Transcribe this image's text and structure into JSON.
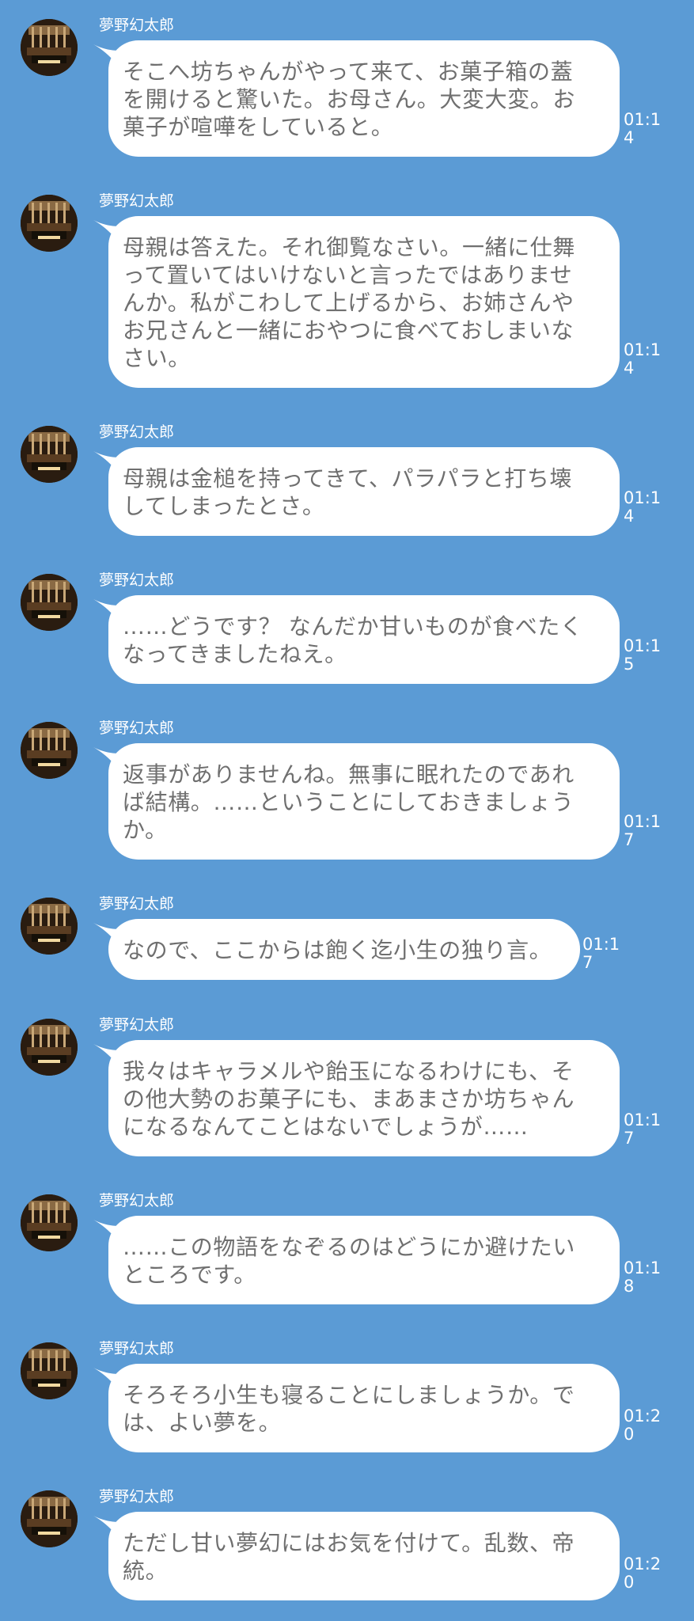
{
  "chat": {
    "messages": [
      {
        "sender": "夢野幻太郎",
        "text": "そこへ坊ちゃんがやって来て、お菓子箱の蓋を開けると驚いた。お母さん。大変大変。お菓子が喧嘩をしていると。",
        "time": "01:14"
      },
      {
        "sender": "夢野幻太郎",
        "text": "母親は答えた。それ御覧なさい。一緒に仕舞って置いてはいけないと言ったではありませんか。私がこわして上げるから、お姉さんやお兄さんと一緒におやつに食べておしまいなさい。",
        "time": "01:14"
      },
      {
        "sender": "夢野幻太郎",
        "text": "母親は金槌を持ってきて、パラパラと打ち壊してしまったとさ。",
        "time": "01:14"
      },
      {
        "sender": "夢野幻太郎",
        "text": "……どうです？ なんだか甘いものが食べたくなってきましたねえ。",
        "time": "01:15"
      },
      {
        "sender": "夢野幻太郎",
        "text": "返事がありませんね。無事に眠れたのであれば結構。……ということにしておきましょうか。",
        "time": "01:17"
      },
      {
        "sender": "夢野幻太郎",
        "text": "なので、ここからは飽く迄小生の独り言。",
        "time": "01:17"
      },
      {
        "sender": "夢野幻太郎",
        "text": "我々はキャラメルや飴玉になるわけにも、その他大勢のお菓子にも、まあまさか坊ちゃんになるなんてことはないでしょうが……",
        "time": "01:17"
      },
      {
        "sender": "夢野幻太郎",
        "text": "……この物語をなぞるのはどうにか避けたいところです。",
        "time": "01:18"
      },
      {
        "sender": "夢野幻太郎",
        "text": "そろそろ小生も寝ることにしましょうか。では、よい夢を。",
        "time": "01:20"
      },
      {
        "sender": "夢野幻太郎",
        "text": "ただし甘い夢幻にはお気を付けて。乱数、帝統。",
        "time": "01:20"
      }
    ]
  },
  "colors": {
    "background": "#5b9bd5",
    "bubble": "#ffffff",
    "message_text": "#6f6f6f",
    "meta_text": "#ffffff"
  },
  "icons": {
    "avatar": "profile-photo-icon"
  }
}
